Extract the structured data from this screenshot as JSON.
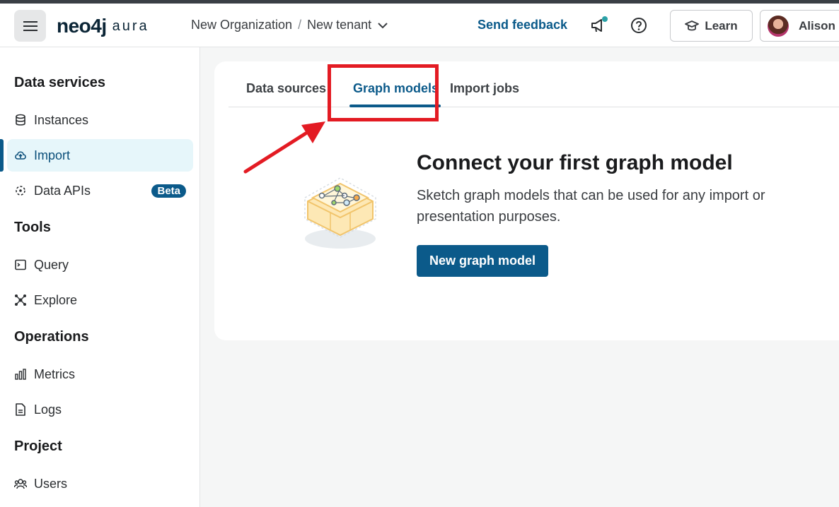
{
  "header": {
    "logo_main": "neo4j",
    "logo_sub": "aura",
    "breadcrumb": {
      "organization": "New Organization",
      "separator": "/",
      "tenant": "New tenant"
    },
    "send_feedback": "Send feedback",
    "learn": "Learn",
    "user_name": "Alison"
  },
  "sidebar": {
    "sections": [
      {
        "title": "Data services",
        "items": [
          {
            "label": "Instances",
            "icon": "database-icon"
          },
          {
            "label": "Import",
            "icon": "cloud-upload-icon",
            "active": true
          },
          {
            "label": "Data APIs",
            "icon": "data-api-icon",
            "badge": "Beta"
          }
        ]
      },
      {
        "title": "Tools",
        "items": [
          {
            "label": "Query",
            "icon": "terminal-icon"
          },
          {
            "label": "Explore",
            "icon": "graph-explore-icon"
          }
        ]
      },
      {
        "title": "Operations",
        "items": [
          {
            "label": "Metrics",
            "icon": "bar-chart-icon"
          },
          {
            "label": "Logs",
            "icon": "document-icon"
          }
        ]
      },
      {
        "title": "Project",
        "items": [
          {
            "label": "Users",
            "icon": "users-icon"
          }
        ]
      }
    ]
  },
  "main": {
    "tabs": [
      {
        "label": "Data sources"
      },
      {
        "label": "Graph models",
        "active": true
      },
      {
        "label": "Import jobs"
      }
    ],
    "empty_state": {
      "title": "Connect your first graph model",
      "description": "Sketch graph models that can be used for any import or presentation purposes.",
      "button": "New graph model"
    }
  },
  "colors": {
    "accent": "#0b5a8a",
    "highlight": "#e31b23",
    "active_nav_bg": "#e6f6fa"
  }
}
